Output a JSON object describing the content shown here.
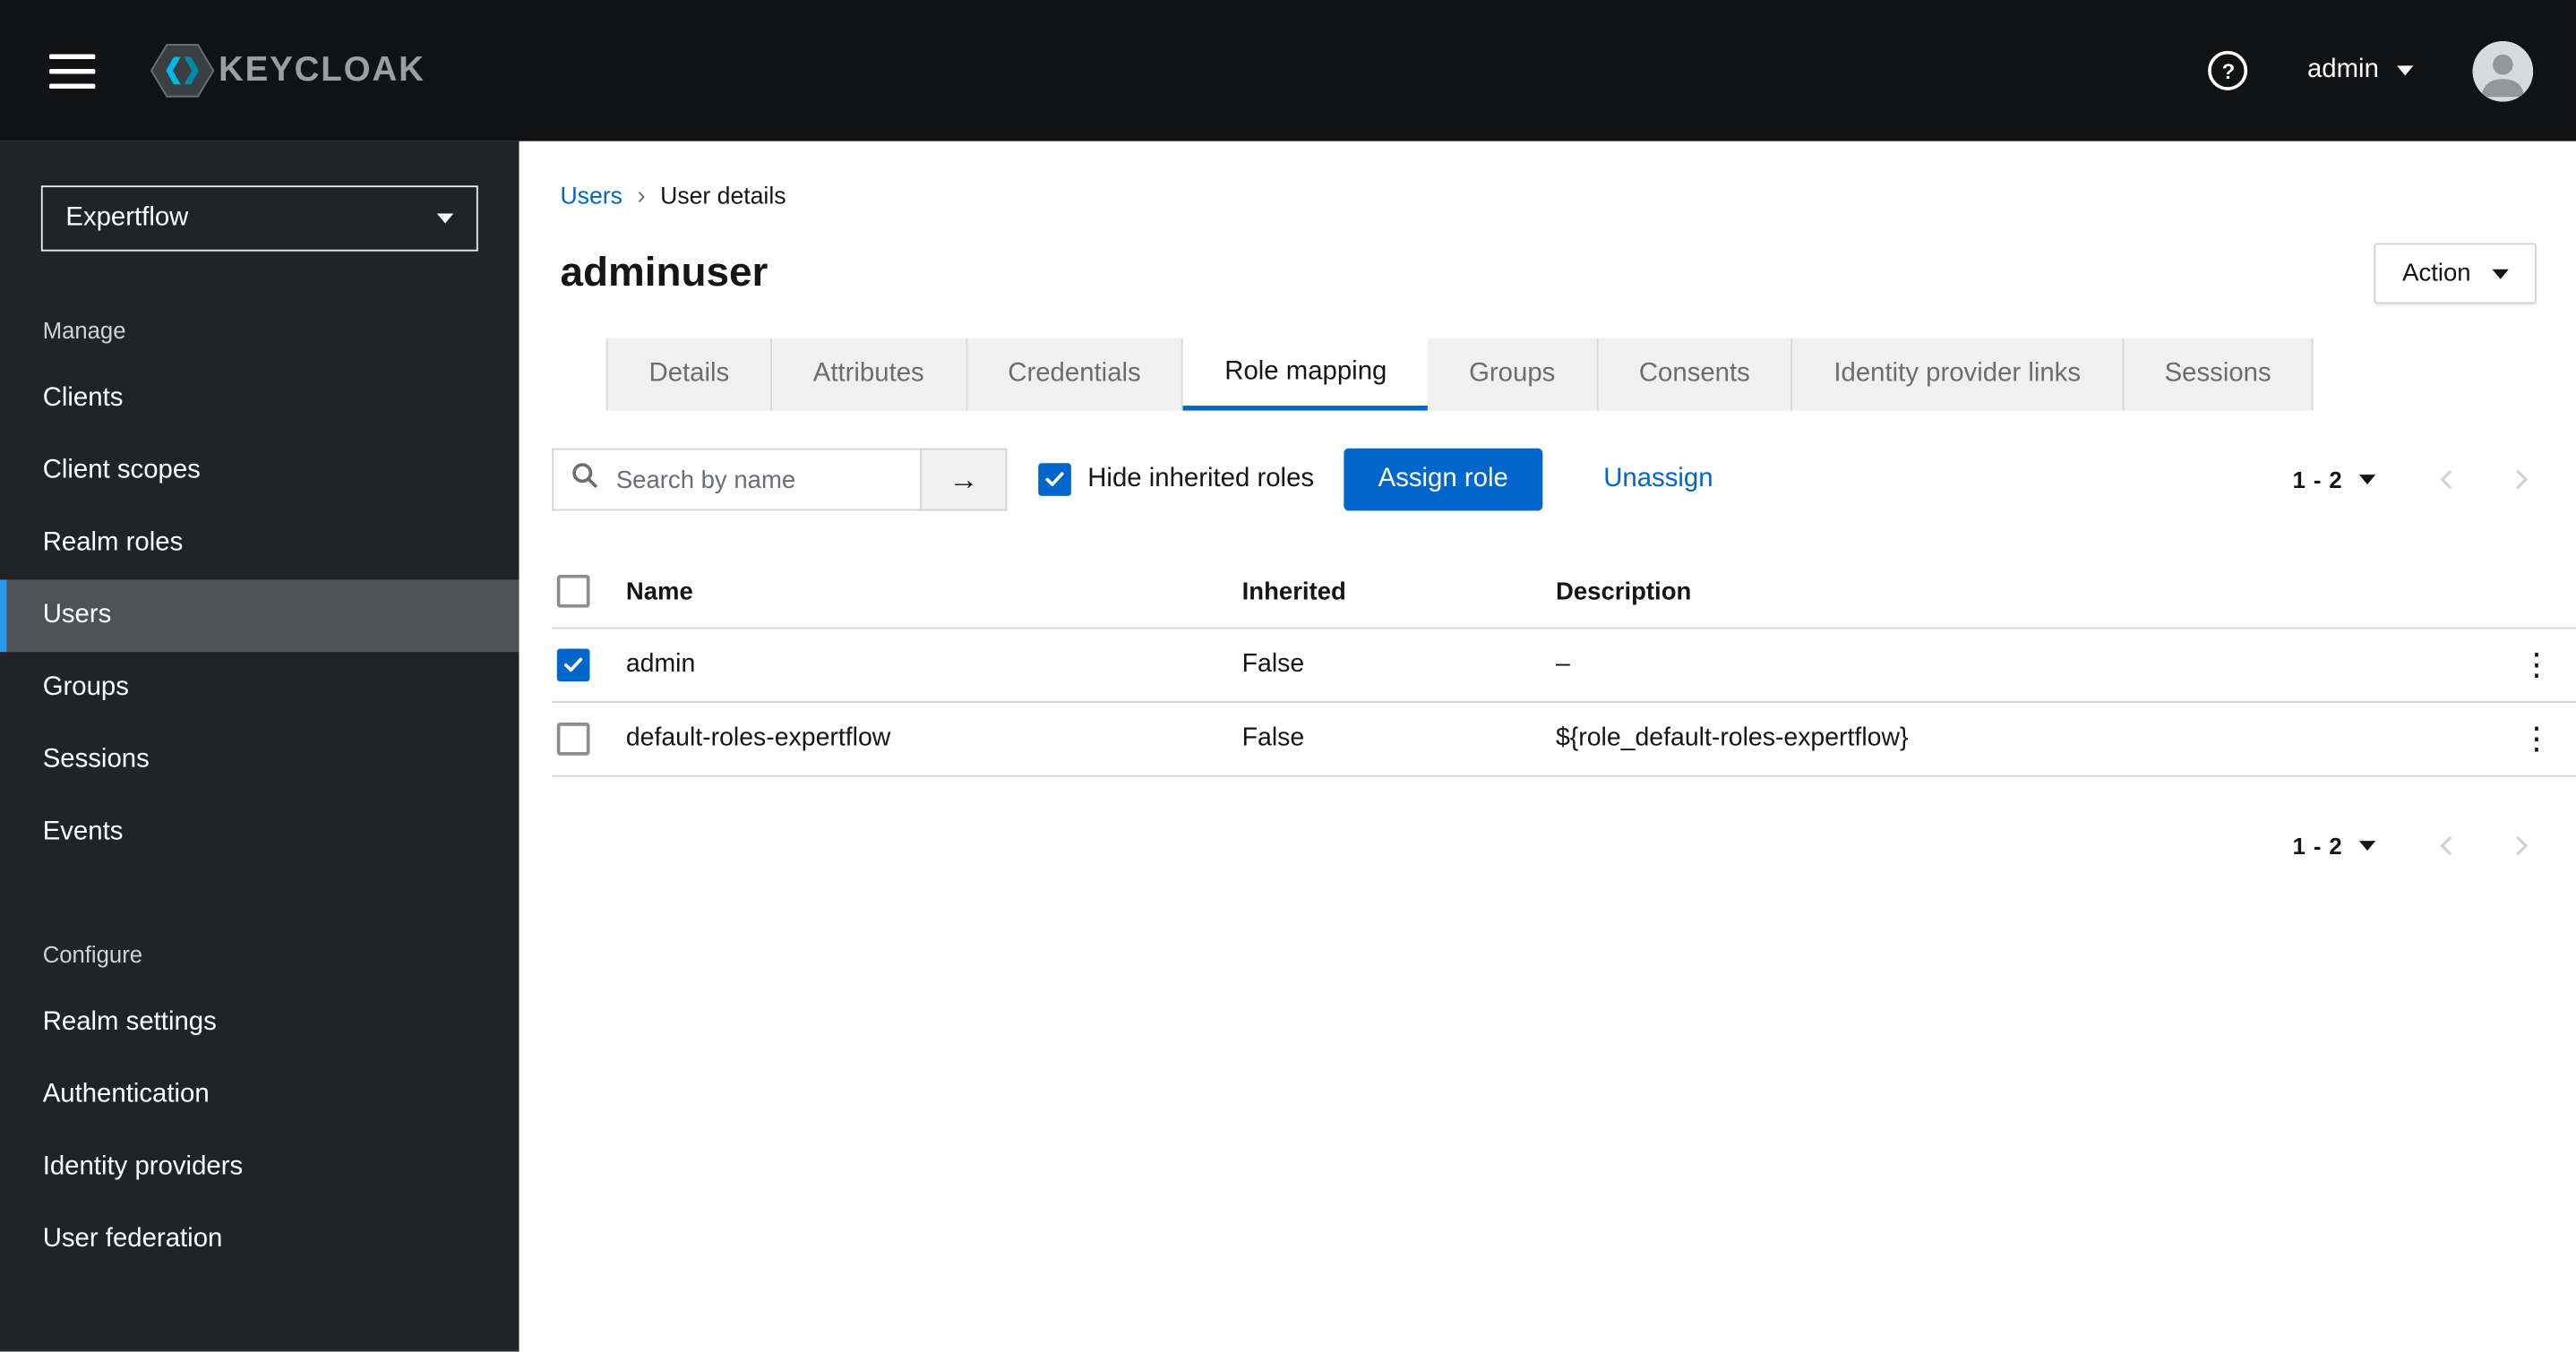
{
  "topbar": {
    "brand": "KEYCLOAK",
    "help_icon": "?",
    "username": "admin"
  },
  "sidebar": {
    "realm": "Expertflow",
    "manage_label": "Manage",
    "manage_items": [
      "Clients",
      "Client scopes",
      "Realm roles",
      "Users",
      "Groups",
      "Sessions",
      "Events"
    ],
    "configure_label": "Configure",
    "configure_items": [
      "Realm settings",
      "Authentication",
      "Identity providers",
      "User federation"
    ],
    "active_item": "Users"
  },
  "breadcrumb": {
    "parent": "Users",
    "separator": "›",
    "current": "User details"
  },
  "page": {
    "title": "adminuser",
    "action_button": "Action"
  },
  "tabs": [
    "Details",
    "Attributes",
    "Credentials",
    "Role mapping",
    "Groups",
    "Consents",
    "Identity provider links",
    "Sessions"
  ],
  "active_tab": "Role mapping",
  "toolbar": {
    "search_placeholder": "Search by name",
    "search_arrow": "→",
    "hide_inherited_label": "Hide inherited roles",
    "hide_inherited_checked": true,
    "assign_role_button": "Assign role",
    "unassign_link": "Unassign"
  },
  "pagination": {
    "range": "1 - 2"
  },
  "table": {
    "headers": {
      "name": "Name",
      "inherited": "Inherited",
      "description": "Description"
    },
    "rows": [
      {
        "name": "admin",
        "inherited": "False",
        "description": "–",
        "checked": true
      },
      {
        "name": "default-roles-expertflow",
        "inherited": "False",
        "description": "${role_default-roles-expertflow}",
        "checked": false
      }
    ]
  },
  "icons": {
    "kebab": "⋮"
  },
  "colors": {
    "accent": "#0066cc",
    "topbar_bg": "#111214",
    "sidebar_bg": "#212427",
    "active_nav_bg": "#4f5255",
    "active_nav_indicator": "#2b9af3",
    "tab_inactive_bg": "#f0f0f0",
    "disabled_gray": "#d2d2d2"
  }
}
